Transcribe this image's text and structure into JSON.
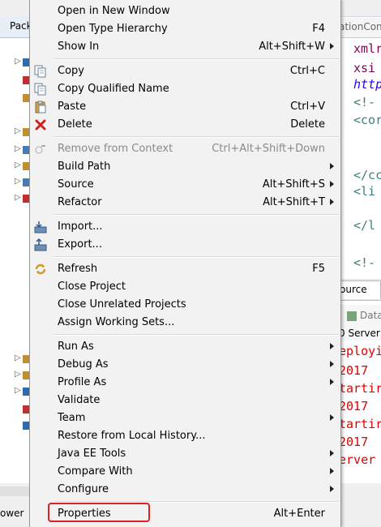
{
  "background": {
    "package_tab": "Pack",
    "editor_tab": "ationConte",
    "code_lines": [
      {
        "text": "xmlr",
        "color": "#7f0055"
      },
      {
        "text": "xsi",
        "color": "#7f0055"
      },
      {
        "text": "http",
        "color": "#2a00ff"
      },
      {
        "text": "<!-",
        "color": "#3f7f5f"
      },
      {
        "text": "<cor",
        "color": "#3f7f7f"
      },
      {
        "text": "</cc",
        "color": "#3f7f7f"
      },
      {
        "text": "<li",
        "color": "#3f7f7f"
      },
      {
        "text": "</l",
        "color": "#3f7f7f"
      },
      {
        "text": "<!-",
        "color": "#3f7f5f"
      }
    ],
    "source_tab": "ource",
    "console_header_top": "Data",
    "console_header_line": "0 Server",
    "console_lines": [
      "eployi",
      " 2017",
      "tartir",
      " 2017",
      "tartir",
      " 2017",
      "erver"
    ],
    "bottom_left_label": "ower"
  },
  "menu": {
    "groups": [
      [
        {
          "label": "Open in New Window",
          "accel": "",
          "submenu": false,
          "icon": "",
          "disabled": false
        },
        {
          "label": "Open Type Hierarchy",
          "accel": "F4",
          "submenu": false,
          "icon": "",
          "disabled": false
        },
        {
          "label": "Show In",
          "accel": "Alt+Shift+W",
          "submenu": true,
          "icon": "",
          "disabled": false
        }
      ],
      [
        {
          "label": "Copy",
          "accel": "Ctrl+C",
          "submenu": false,
          "icon": "copy-icon",
          "disabled": false
        },
        {
          "label": "Copy Qualified Name",
          "accel": "",
          "submenu": false,
          "icon": "copy-qualified-name-icon",
          "disabled": false
        },
        {
          "label": "Paste",
          "accel": "Ctrl+V",
          "submenu": false,
          "icon": "paste-icon",
          "disabled": false
        },
        {
          "label": "Delete",
          "accel": "Delete",
          "submenu": false,
          "icon": "delete-icon",
          "disabled": false
        }
      ],
      [
        {
          "label": "Remove from Context",
          "accel": "Ctrl+Alt+Shift+Down",
          "submenu": false,
          "icon": "remove-context-icon",
          "disabled": true
        },
        {
          "label": "Build Path",
          "accel": "",
          "submenu": true,
          "icon": "",
          "disabled": false
        },
        {
          "label": "Source",
          "accel": "Alt+Shift+S",
          "submenu": true,
          "icon": "",
          "disabled": false
        },
        {
          "label": "Refactor",
          "accel": "Alt+Shift+T",
          "submenu": true,
          "icon": "",
          "disabled": false
        }
      ],
      [
        {
          "label": "Import...",
          "accel": "",
          "submenu": false,
          "icon": "import-icon",
          "disabled": false
        },
        {
          "label": "Export...",
          "accel": "",
          "submenu": false,
          "icon": "export-icon",
          "disabled": false
        }
      ],
      [
        {
          "label": "Refresh",
          "accel": "F5",
          "submenu": false,
          "icon": "refresh-icon",
          "disabled": false
        },
        {
          "label": "Close Project",
          "accel": "",
          "submenu": false,
          "icon": "",
          "disabled": false
        },
        {
          "label": "Close Unrelated Projects",
          "accel": "",
          "submenu": false,
          "icon": "",
          "disabled": false
        },
        {
          "label": "Assign Working Sets...",
          "accel": "",
          "submenu": false,
          "icon": "",
          "disabled": false
        }
      ],
      [
        {
          "label": "Run As",
          "accel": "",
          "submenu": true,
          "icon": "",
          "disabled": false
        },
        {
          "label": "Debug As",
          "accel": "",
          "submenu": true,
          "icon": "",
          "disabled": false
        },
        {
          "label": "Profile As",
          "accel": "",
          "submenu": true,
          "icon": "",
          "disabled": false
        },
        {
          "label": "Validate",
          "accel": "",
          "submenu": false,
          "icon": "",
          "disabled": false
        },
        {
          "label": "Team",
          "accel": "",
          "submenu": true,
          "icon": "",
          "disabled": false
        },
        {
          "label": "Restore from Local History...",
          "accel": "",
          "submenu": false,
          "icon": "",
          "disabled": false
        },
        {
          "label": "Java EE Tools",
          "accel": "",
          "submenu": true,
          "icon": "",
          "disabled": false
        },
        {
          "label": "Compare With",
          "accel": "",
          "submenu": true,
          "icon": "",
          "disabled": false
        },
        {
          "label": "Configure",
          "accel": "",
          "submenu": true,
          "icon": "",
          "disabled": false
        }
      ],
      [
        {
          "label": "Properties",
          "accel": "Alt+Enter",
          "submenu": false,
          "icon": "",
          "disabled": false,
          "highlighted": true
        }
      ]
    ]
  },
  "colors": {
    "highlight_border": "#e02020",
    "disabled_text": "#8a8a8a",
    "console_error": "#e00000"
  }
}
